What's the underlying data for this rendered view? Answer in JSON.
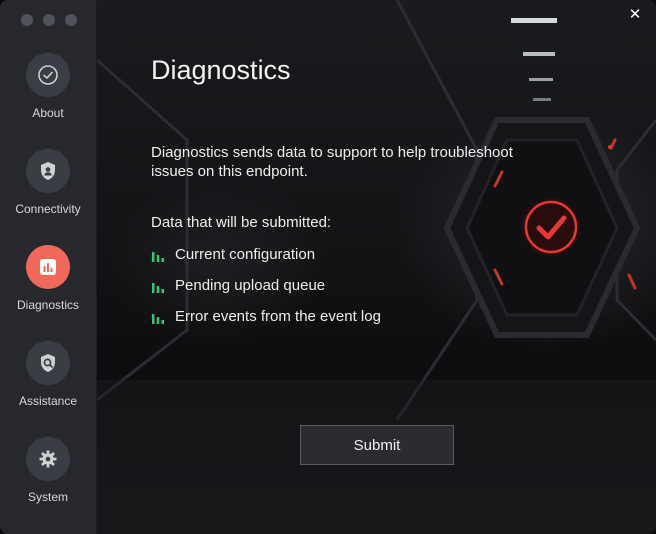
{
  "sidebar": {
    "items": [
      {
        "label": "About",
        "icon": "check-circle-icon",
        "active": false
      },
      {
        "label": "Connectivity",
        "icon": "shield-icon",
        "active": false
      },
      {
        "label": "Diagnostics",
        "icon": "bar-chart-icon",
        "active": true
      },
      {
        "label": "Assistance",
        "icon": "shield-search-icon",
        "active": false
      },
      {
        "label": "System",
        "icon": "gear-icon",
        "active": false
      }
    ]
  },
  "main": {
    "close_glyph": "✕",
    "title": "Diagnostics",
    "description": "Diagnostics sends data to support to help troubleshoot issues on this endpoint.",
    "subhead": "Data that will be submitted:",
    "items": [
      "Current configuration",
      "Pending upload queue",
      "Error events from the event log"
    ],
    "item_icon": "bar-chart-icon",
    "item_icon_color": "#2ecc71",
    "submit_label": "Submit"
  },
  "colors": {
    "accent": "#f0685a",
    "status_badge": "#e53935",
    "sidebar_bg": "#26282d"
  }
}
